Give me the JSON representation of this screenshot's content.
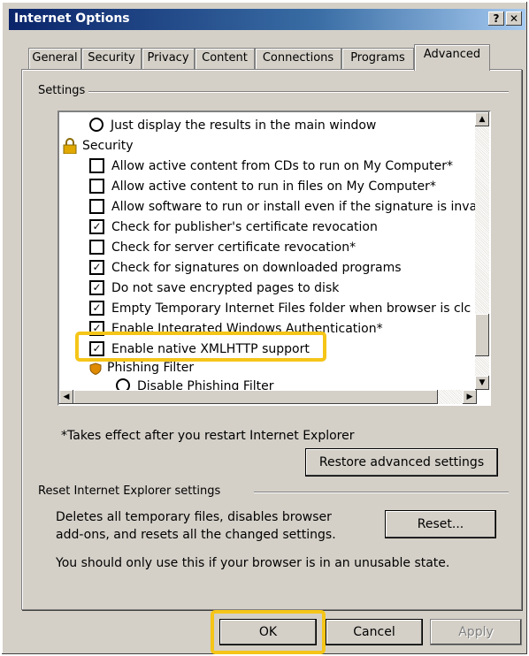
{
  "window": {
    "title": "Internet Options",
    "help_button": "?",
    "close_button": "✕"
  },
  "tabs": [
    {
      "label": "General"
    },
    {
      "label": "Security"
    },
    {
      "label": "Privacy"
    },
    {
      "label": "Content"
    },
    {
      "label": "Connections"
    },
    {
      "label": "Programs"
    },
    {
      "label": "Advanced",
      "active": true
    }
  ],
  "settings": {
    "group_label": "Settings",
    "items": [
      {
        "type": "radio",
        "label": "Just display the results in the main window"
      },
      {
        "type": "category",
        "label": "Security",
        "icon": "lock-icon"
      },
      {
        "type": "checkbox",
        "checked": false,
        "label": "Allow active content from CDs to run on My Computer*"
      },
      {
        "type": "checkbox",
        "checked": false,
        "label": "Allow active content to run in files on My Computer*"
      },
      {
        "type": "checkbox",
        "checked": false,
        "label": "Allow software to run or install even if the signature is inva"
      },
      {
        "type": "checkbox",
        "checked": true,
        "label": "Check for publisher's certificate revocation"
      },
      {
        "type": "checkbox",
        "checked": false,
        "label": "Check for server certificate revocation*"
      },
      {
        "type": "checkbox",
        "checked": true,
        "label": "Check for signatures on downloaded programs"
      },
      {
        "type": "checkbox",
        "checked": true,
        "label": "Do not save encrypted pages to disk"
      },
      {
        "type": "checkbox",
        "checked": true,
        "label": "Empty Temporary Internet Files folder when browser is clc"
      },
      {
        "type": "checkbox",
        "checked": true,
        "label": "Enable Integrated Windows Authentication*"
      },
      {
        "type": "checkbox",
        "checked": true,
        "label": "Enable native XMLHTTP support",
        "highlighted": true
      },
      {
        "type": "category",
        "label": "Phishing Filter",
        "icon": "shield-icon"
      },
      {
        "type": "radio",
        "label": "Disable Phishing Filter"
      }
    ],
    "footnote": "*Takes effect after you restart Internet Explorer",
    "restore_button": "Restore advanced settings"
  },
  "reset": {
    "group_label": "Reset Internet Explorer settings",
    "description_line1": "Deletes all temporary files, disables browser",
    "description_line2": "add-ons, and resets all the changed settings.",
    "reset_button": "Reset...",
    "warning": "You should only use this if your browser is in an unusable state."
  },
  "footer": {
    "ok": "OK",
    "cancel": "Cancel",
    "apply": "Apply"
  },
  "colors": {
    "highlight": "#f5c518",
    "titlebar": "#0a246a"
  }
}
